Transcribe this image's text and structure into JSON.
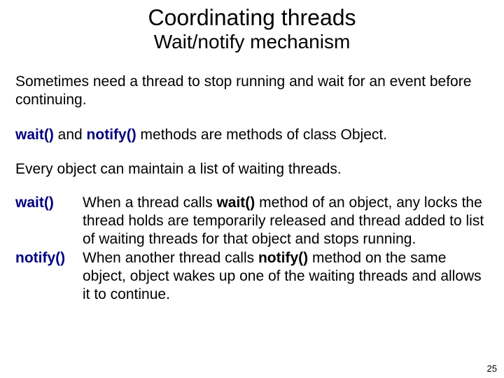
{
  "title": "Coordinating threads",
  "subtitle": "Wait/notify mechanism",
  "intro": "Sometimes need a thread to stop running and wait for an event before continuing.",
  "methods_line": {
    "m1": " wait()",
    "and": " and ",
    "m2": "notify()",
    "rest": " methods are methods of class Object."
  },
  "every_object": "Every object can maintain a list of waiting threads.",
  "defs": {
    "wait": {
      "label": "wait()",
      "d1": "When a thread calls ",
      "b1": "wait()",
      "d2": " method of an object, any locks the thread holds are temporarily released and thread added to list of waiting threads for that object and stops running."
    },
    "notify": {
      "label": "notify()",
      "d1": "When another thread calls ",
      "b1": "notify()",
      "d2": " method on the same object, object wakes up one of the waiting threads and allows it to continue."
    }
  },
  "page_number": "25"
}
